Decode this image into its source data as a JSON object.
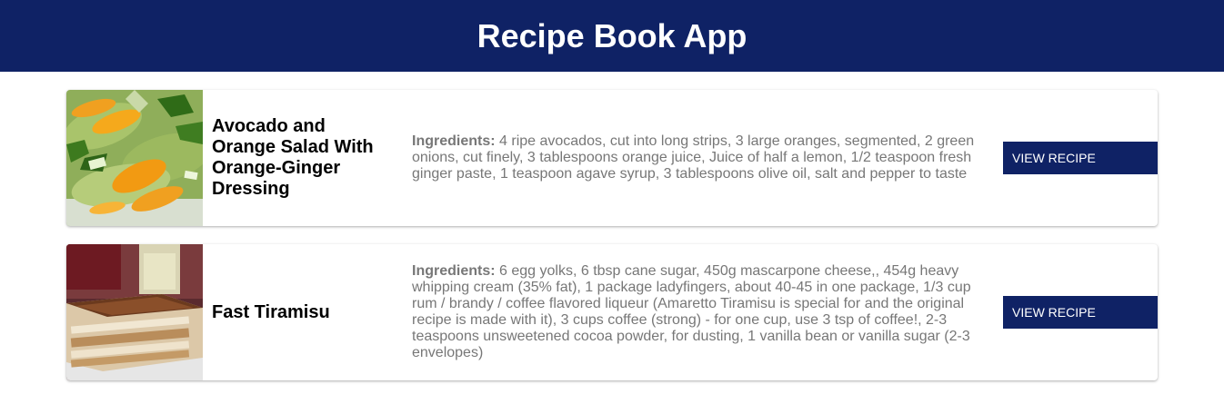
{
  "header": {
    "title": "Recipe Book App",
    "background_color": "#0f2265"
  },
  "recipes": [
    {
      "name": "Avocado and Orange Salad With Orange-Ginger Dressing",
      "ingredients_label": "Ingredients:",
      "ingredients": "4 ripe avocados, cut into long strips, 3 large oranges, segmented, 2 green onions, cut finely, 3 tablespoons orange juice, Juice of half a lemon, 1/2 teaspoon fresh ginger paste, 1 teaspoon agave syrup, 3 tablespoons olive oil, salt and pepper to taste",
      "button_label": "VIEW RECIPE",
      "image": "avocado-orange-salad-photo"
    },
    {
      "name": "Fast Tiramisu",
      "ingredients_label": "Ingredients:",
      "ingredients": "6 egg yolks, 6 tbsp cane sugar, 450g mascarpone cheese,, 454g heavy whipping cream (35% fat), 1 package ladyfingers, about 40-45 in one package, 1/3 cup rum / brandy / coffee flavored liqueur (Amaretto Tiramisu is special for and the original recipe is made with it), 3 cups coffee (strong) - for one cup, use 3 tsp of coffee!, 2-3 teaspoons unsweetened cocoa powder, for dusting, 1 vanilla bean or vanilla sugar (2-3 envelopes)",
      "button_label": "VIEW RECIPE",
      "image": "tiramisu-photo"
    }
  ],
  "colors": {
    "accent": "#0f2265",
    "ingredients_text": "#777777"
  }
}
